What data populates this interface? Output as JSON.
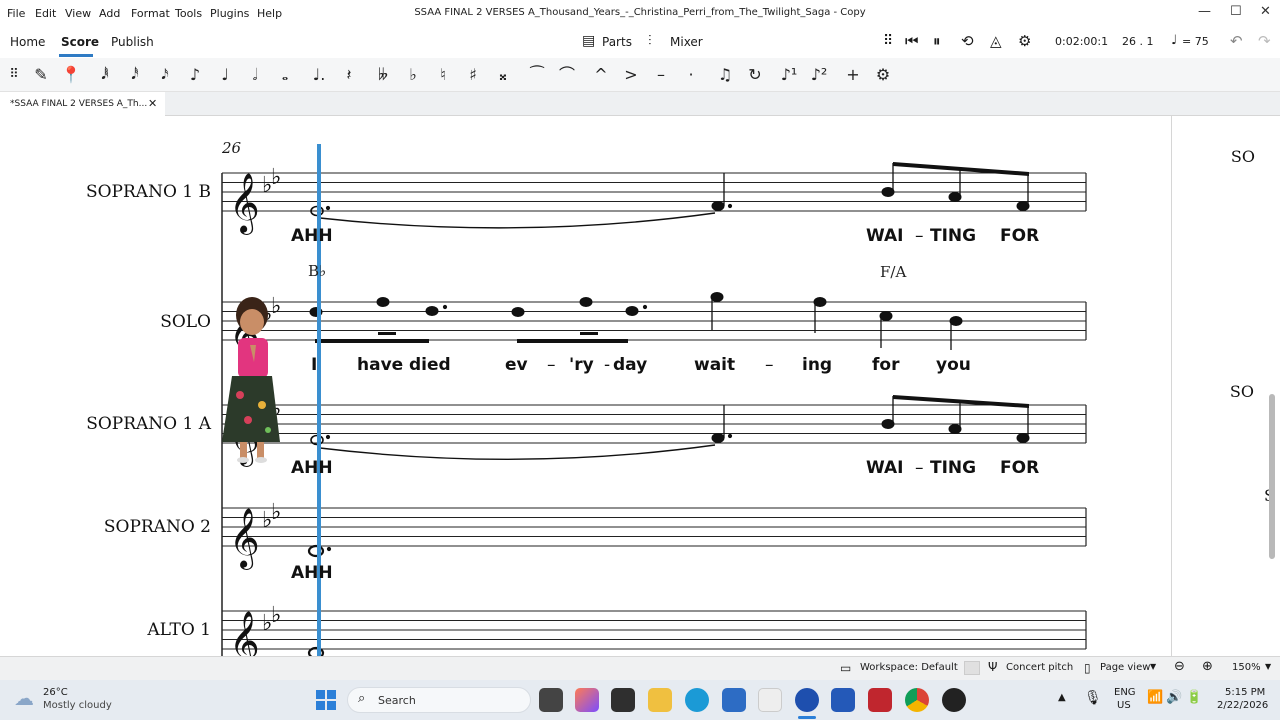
{
  "menubar": {
    "items": [
      "File",
      "Edit",
      "View",
      "Add",
      "Format",
      "Tools",
      "Plugins",
      "Help"
    ],
    "title": "SSAA FINAL 2 VERSES A_Thousand_Years_-_Christina_Perri_from_The_Twilight_Saga - Copy"
  },
  "nav": {
    "home": "Home",
    "score": "Score",
    "publish": "Publish",
    "parts": "Parts",
    "mixer": "Mixer",
    "time": "0:02:00:1",
    "position": "26 . 1",
    "tempo": "= 75"
  },
  "tab": {
    "label": "*SSAA FINAL 2 VERSES A_Th..."
  },
  "score": {
    "measure_number": "26",
    "staves": [
      {
        "name": "SOPRANO 1 B",
        "lyrics": [
          "AHH",
          "WAI",
          "–",
          "TING",
          "FOR"
        ]
      },
      {
        "name": "SOLO",
        "chords": [
          "B♭",
          "F/A"
        ],
        "lyrics": [
          "I",
          "have",
          "died",
          "ev",
          "–",
          "'ry",
          "-",
          "day",
          "wait",
          "–",
          "ing",
          "for",
          "you"
        ]
      },
      {
        "name": "SOPRANO 1 A",
        "lyrics": [
          "AHH",
          "WAI",
          "–",
          "TING",
          "FOR"
        ]
      },
      {
        "name": "SOPRANO 2",
        "lyrics": [
          "AHH"
        ]
      },
      {
        "name": "ALTO 1"
      }
    ],
    "right_labels": [
      "SO",
      "SO",
      "S"
    ]
  },
  "status": {
    "workspace": "Workspace: Default",
    "concert": "Concert pitch",
    "pageview": "Page view",
    "zoom": "150%"
  },
  "taskbar": {
    "temp": "26°C",
    "weather": "Mostly cloudy",
    "search": "Search",
    "lang1": "ENG",
    "lang2": "US",
    "clock": "5:15 PM",
    "date": "2/22/2026"
  },
  "colors": {
    "accent": "#2f7bc4",
    "cursor": "#3a8fd0",
    "staff": "#222222"
  }
}
